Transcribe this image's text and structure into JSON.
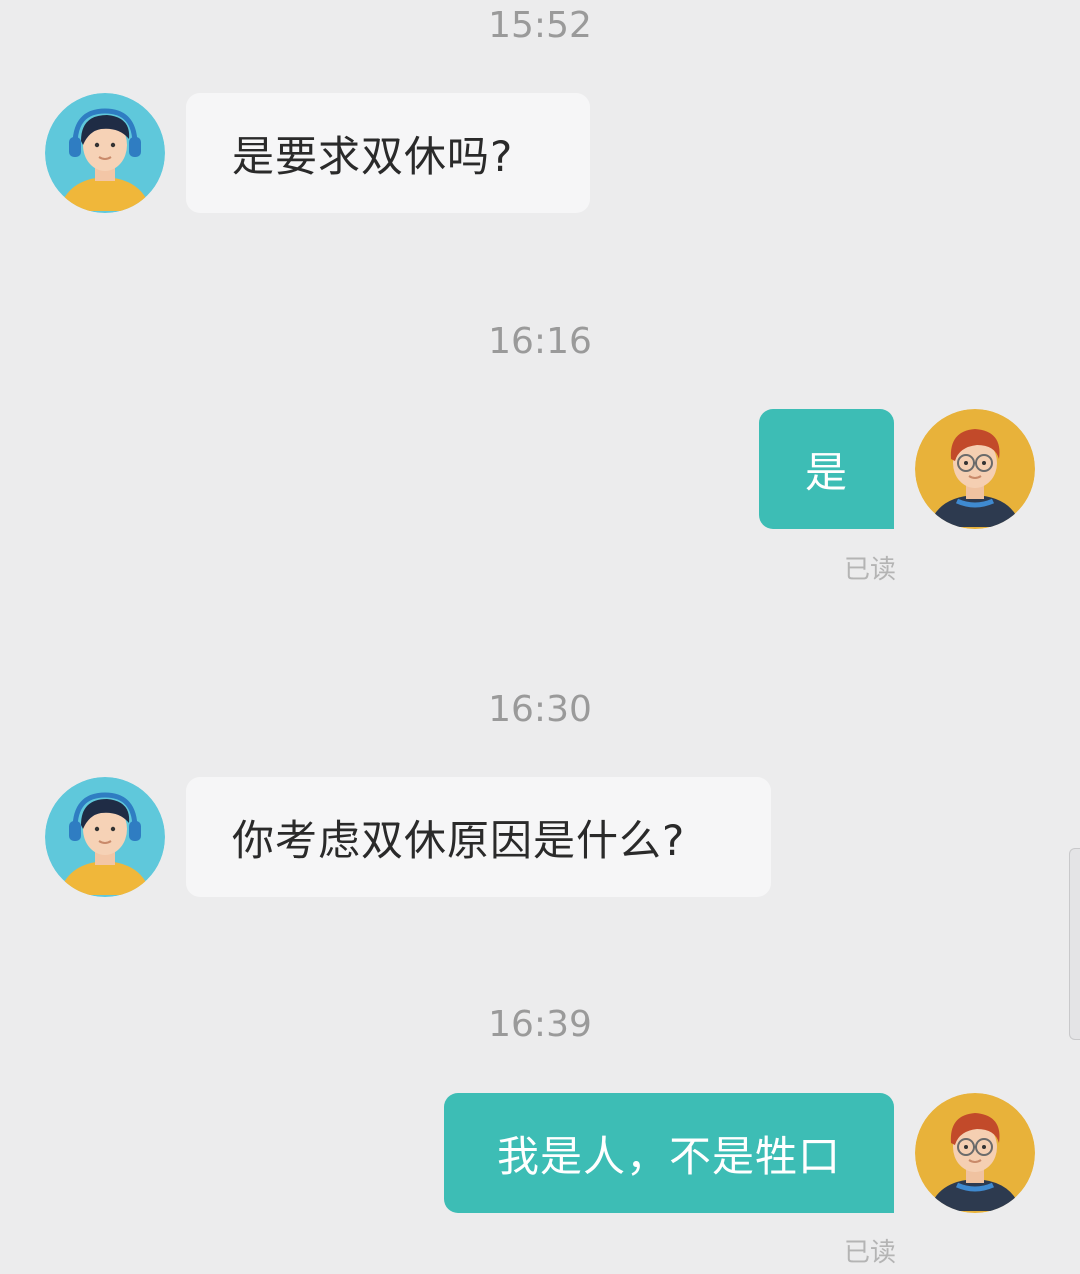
{
  "messages": [
    {
      "time": "15:52",
      "side": "in",
      "text": "是要求双休吗?",
      "avatar": "agent-avatar-headset"
    },
    {
      "time": "16:16",
      "side": "out",
      "text": "是",
      "status": "已读",
      "avatar": "user-avatar-glasses"
    },
    {
      "time": "16:30",
      "side": "in",
      "text": "你考虑双休原因是什么?",
      "avatar": "agent-avatar-headset"
    },
    {
      "time": "16:39",
      "side": "out",
      "text": "我是人，不是牲口",
      "status": "已读",
      "avatar": "user-avatar-glasses"
    }
  ],
  "colors": {
    "background": "#ececed",
    "incoming_bubble": "#f6f6f7",
    "outgoing_bubble": "#3dbdb5",
    "timestamp": "#9a9a9a",
    "read_status": "#b4b4b4"
  }
}
